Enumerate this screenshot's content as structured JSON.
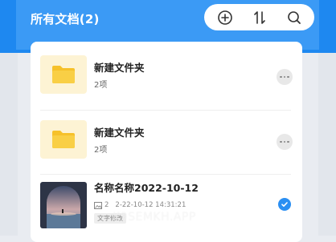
{
  "header": {
    "title": "所有文档(2)",
    "actions": [
      "add-icon",
      "sort-icon",
      "search-icon"
    ]
  },
  "items": [
    {
      "type": "folder",
      "title": "新建文件夹",
      "subtitle": "2项",
      "icon": "folder-icon"
    },
    {
      "type": "folder",
      "title": "新建文件夹",
      "subtitle": "2项",
      "icon": "folder-icon"
    },
    {
      "type": "document",
      "title": "名称名称2022-10-12",
      "count": "2",
      "date": "2-22-10-12  14:31:21",
      "tag": "文字修改",
      "selected": true
    }
  ],
  "watermark": "K9SEMKH.APP",
  "colors": {
    "primary": "#3b9af5",
    "folder": "#f6c12a",
    "folder_bg": "#fdf3d4",
    "check": "#2b8ff2"
  }
}
